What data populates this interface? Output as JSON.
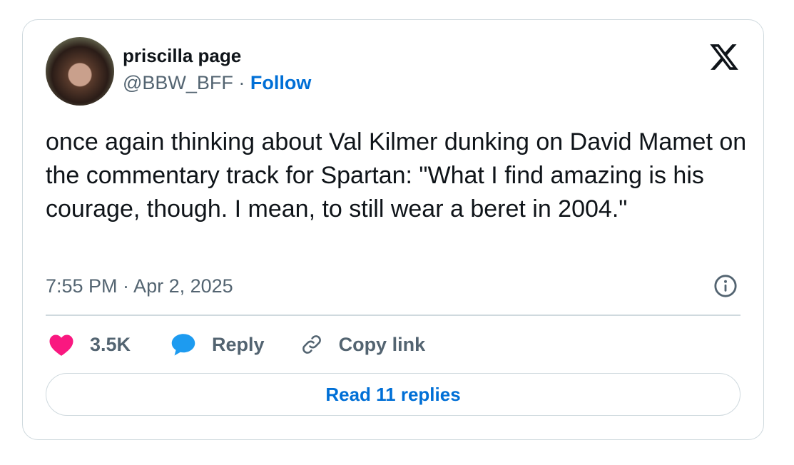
{
  "author": {
    "display_name": "priscilla page",
    "handle": "@BBW_BFF",
    "separator": " · ",
    "follow_label": "Follow"
  },
  "tweet": {
    "text": "once again thinking about Val Kilmer dunking on David Mamet on the commentary track for Spartan: \"What I find amazing is his courage, though. I mean, to still wear a beret in 2004.\"",
    "timestamp": "7:55 PM · Apr 2, 2025"
  },
  "actions": {
    "like_count": "3.5K",
    "reply_label": "Reply",
    "copy_link_label": "Copy link"
  },
  "read_replies_label": "Read 11 replies",
  "colors": {
    "like": "#f91880",
    "reply": "#1d9bf0",
    "link": "#006fd6",
    "muted": "#536471",
    "border": "#cfd9de"
  },
  "icons": {
    "logo": "x-logo-icon",
    "info": "info-icon",
    "like": "heart-icon",
    "reply": "speech-bubble-icon",
    "copy": "link-icon"
  }
}
